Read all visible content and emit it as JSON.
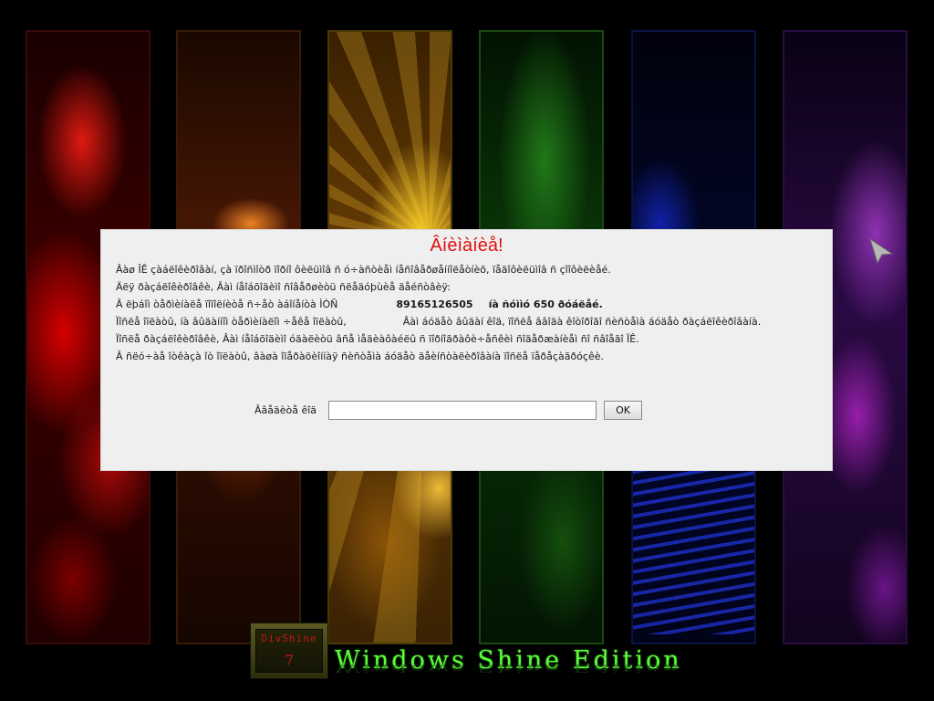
{
  "dialog": {
    "title": "Âíèìàíèå!",
    "lines": [
      [
        "Âàø ÎÊ çàáëîêèðîâàí, çà ïðîñìîòð ïîðíî ôèëüìîâ ñ ó÷àñòèåì íåñîâåðøåííîëåòíèõ, ïåäîôèëüìîâ ñ çîîôèëèåé."
      ],
      [
        "Äëÿ ðàçáëîêèðîâêè, Âàì íåîáõîäèìî ñîâåðøèòü ñëåäóþùèå äåéñòâèÿ:"
      ],
      [
        "Â ëþáîì òåðìèíàëå ïîïîëíèòå ñ÷åò àáîíåíòà ÌÒÑ",
        "89165126505",
        "íà ñóììó 650 ðóáëåé."
      ],
      [
        "Ïîñëå  îïëàòû, íà âûäàííîì òåðìèíàëîì ÷åêå îïëàòû,",
        "Âàì áóäåò âûäàí êîä, ïîñëå ââîäà êîòîðîãî ñèñòåìà áóäåò ðàçáëîêèðîâàíà."
      ],
      [
        "Ïîñëå ðàçáëîêèðîâêè, Âàì íåîáõîäèìî óäàëèòü âñå ìåäèàôàéëû ñ ïîðíîãðàôè÷åñêèì ñîäåðæàíèåì ñî ñâîåãî ÏÊ."
      ],
      [
        "Â ñëó÷àå îòêàçà îò îïëàòû, âàøà îïåðàöèîííàÿ ñèñòåìà áóäåò äåèíñòàëèðîâàíà ïîñëå ïåðåçàãðóçêè."
      ]
    ],
    "code_label": "Ââåäèòå êîä",
    "code_value": "",
    "ok_label": "OK",
    "title_color": "#e01010"
  },
  "branding": {
    "logo_name": "DivShine",
    "logo_number": "7",
    "edition_text": "Windows Shine Edition",
    "edition_color": "#5cff3a"
  },
  "background_panels": [
    {
      "name": "red",
      "color": "#e01010"
    },
    {
      "name": "orange",
      "color": "#e06a10"
    },
    {
      "name": "yellow",
      "color": "#ffc820"
    },
    {
      "name": "green",
      "color": "#2ea020"
    },
    {
      "name": "blue",
      "color": "#1020e0"
    },
    {
      "name": "purple",
      "color": "#b030d0"
    }
  ],
  "cursor_icon": "arrow-cursor-icon"
}
